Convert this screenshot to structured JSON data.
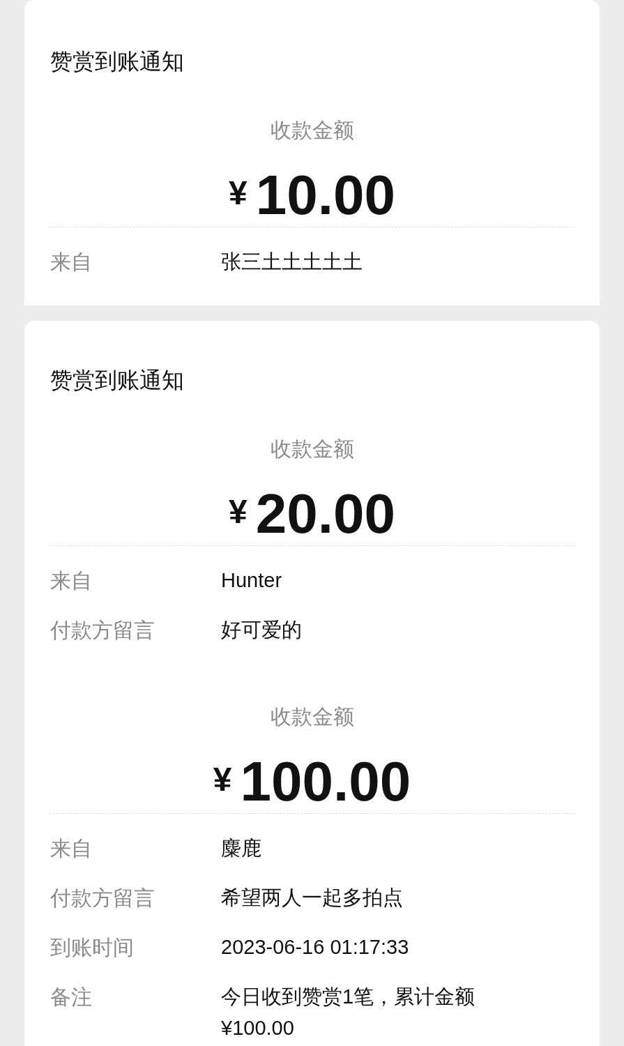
{
  "panels": [
    {
      "title": "赞赏到账通知",
      "amount_label": "收款金额",
      "currency": "¥",
      "amount": "10.00",
      "rows": [
        {
          "label": "来自",
          "value": "张三土土土土土"
        }
      ]
    },
    {
      "title": "赞赏到账通知",
      "amount_label": "收款金额",
      "currency": "¥",
      "amount": "20.00",
      "rows": [
        {
          "label": "来自",
          "value": "Hunter"
        },
        {
          "label": "付款方留言",
          "value": "好可爱的"
        }
      ]
    },
    {
      "amount_label": "收款金额",
      "currency": "¥",
      "amount": "100.00",
      "rows": [
        {
          "label": "来自",
          "value": "麋鹿"
        },
        {
          "label": "付款方留言",
          "value": "希望两人一起多拍点"
        },
        {
          "label": "到账时间",
          "value": "2023-06-16 01:17:33"
        },
        {
          "label": "备注",
          "value": "今日收到赞赏1笔，累计金额¥100.00"
        }
      ]
    }
  ]
}
